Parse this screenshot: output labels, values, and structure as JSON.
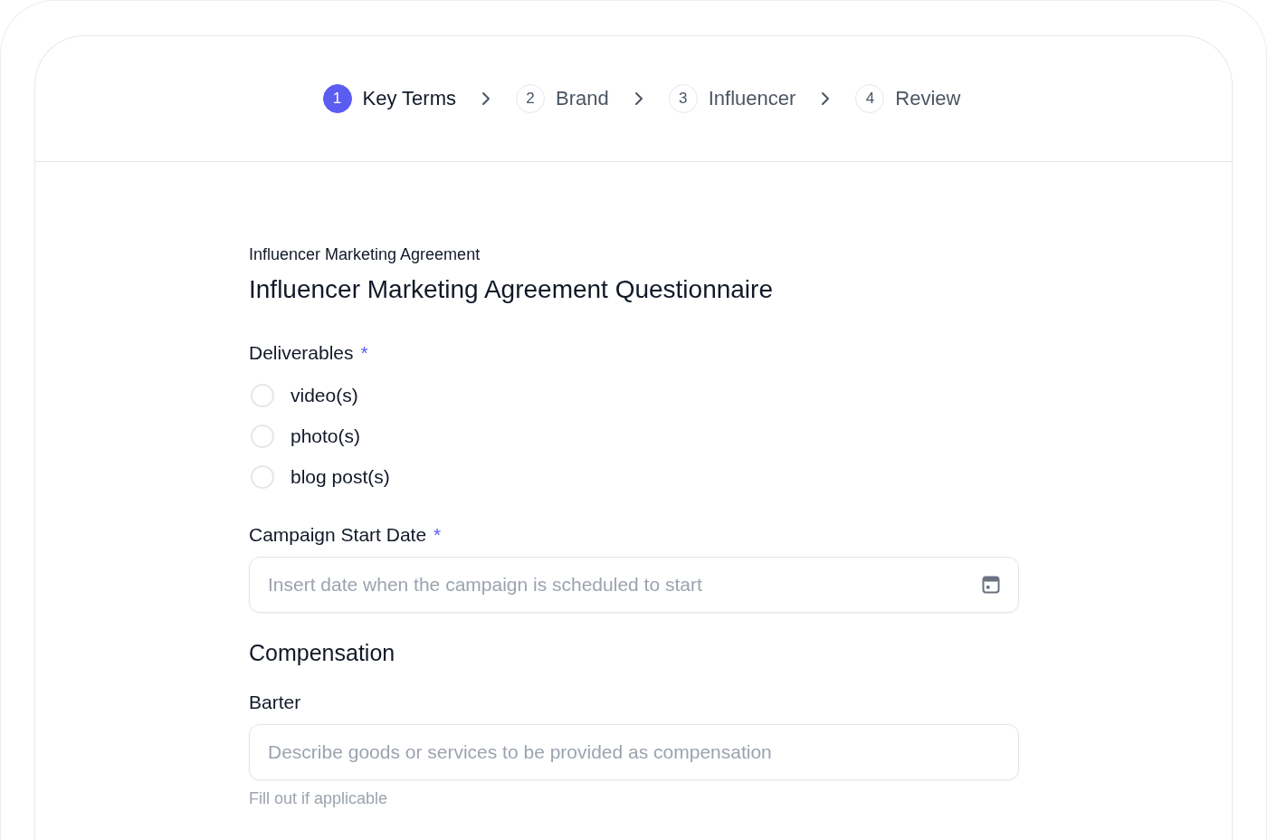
{
  "steps": [
    {
      "number": "1",
      "label": "Key Terms",
      "selected": true
    },
    {
      "number": "2",
      "label": "Brand",
      "selected": false
    },
    {
      "number": "3",
      "label": "Influencer",
      "selected": false
    },
    {
      "number": "4",
      "label": "Review",
      "selected": false
    }
  ],
  "form": {
    "subtitle": "Influencer Marketing Agreement",
    "title": "Influencer Marketing Agreement Questionnaire",
    "sections": [
      {
        "kind": "radio",
        "label": "Deliverables",
        "required_mark": "*",
        "options": [
          {
            "label": "video(s)",
            "checked": false
          },
          {
            "label": "photo(s)",
            "checked": false
          },
          {
            "label": "blog post(s)",
            "checked": false
          }
        ]
      },
      {
        "kind": "date",
        "label": "Campaign Start Date",
        "required_mark": "*",
        "placeholder": "Insert date when the campaign is scheduled to start"
      },
      {
        "kind": "heading",
        "label": "Compensation"
      },
      {
        "kind": "text",
        "label": "Barter",
        "placeholder": "Describe goods or services to be provided as compensation",
        "hint": "Fill out if applicable"
      }
    ]
  }
}
